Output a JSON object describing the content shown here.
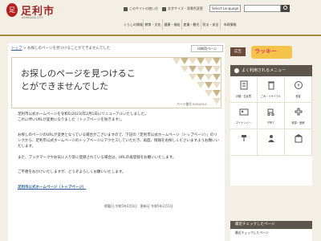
{
  "header": {
    "logo_char": "足",
    "title": "足利市",
    "subtitle": "ASHIKAGA CITY",
    "utils": [
      "このサイトの使い方",
      "文字サイズ・背景色変更",
      "Select Language"
    ],
    "nav": [
      "くらしの情報",
      "教育・文化",
      "健康・福祉",
      "産業・観光",
      "防災・安全",
      "市政情報"
    ]
  },
  "main": {
    "breadcrumb_home": "トップ",
    "breadcrumb_sep": " > ",
    "breadcrumb_current": "お探しのページを見つけることができませんでした",
    "print_label": "印刷用ページ",
    "title": "お探しのページを見つけることができませんでした",
    "page_number": "ページ番号 P.004310",
    "paragraphs": [
      "足利市公式ホームページを令和5(2023)年2月1日にリニューアルいたしました。",
      "これに伴いURLが変更になりました（トップページを除きます）。",
      "お探しのページのURLが変更となっている場合がございますので、下記の「足利市公式ホームページ（トップページ）」のリンクから、足利市公式ホームページのトップページにアクセスしていただき、再度、情報をお探しくださいますようお願いいたします。",
      "また、ブックマークやお気に入り等に登録されている場合は、URLの再登録をお願いいたします。",
      "ご不便をおかけいたしますが、どうぞよろしくお願いいたします。"
    ],
    "top_link": "足利市公式ホームページ（トップページ）",
    "registered": "掲載日 令和5年2月1日",
    "updated": "更新日 令和5年2月1日"
  },
  "sidebar": {
    "ad_label": "広告",
    "ad_text": "ラッキー",
    "menu_title": "よく利用されるメニュー",
    "menu_items": [
      "戸籍・住民票",
      "ごみ・リサイクル",
      "税金",
      "マイナンバー",
      "子育て",
      "健康・医療",
      "",
      "",
      ""
    ],
    "recent_title": "最近チェックしたページ",
    "recent_text": "最近チェックしたページ"
  },
  "colors": {
    "accent": "#b41f1f",
    "gold": "#a8883e",
    "menu_head": "#5e554c",
    "link": "#2b5f9f"
  }
}
